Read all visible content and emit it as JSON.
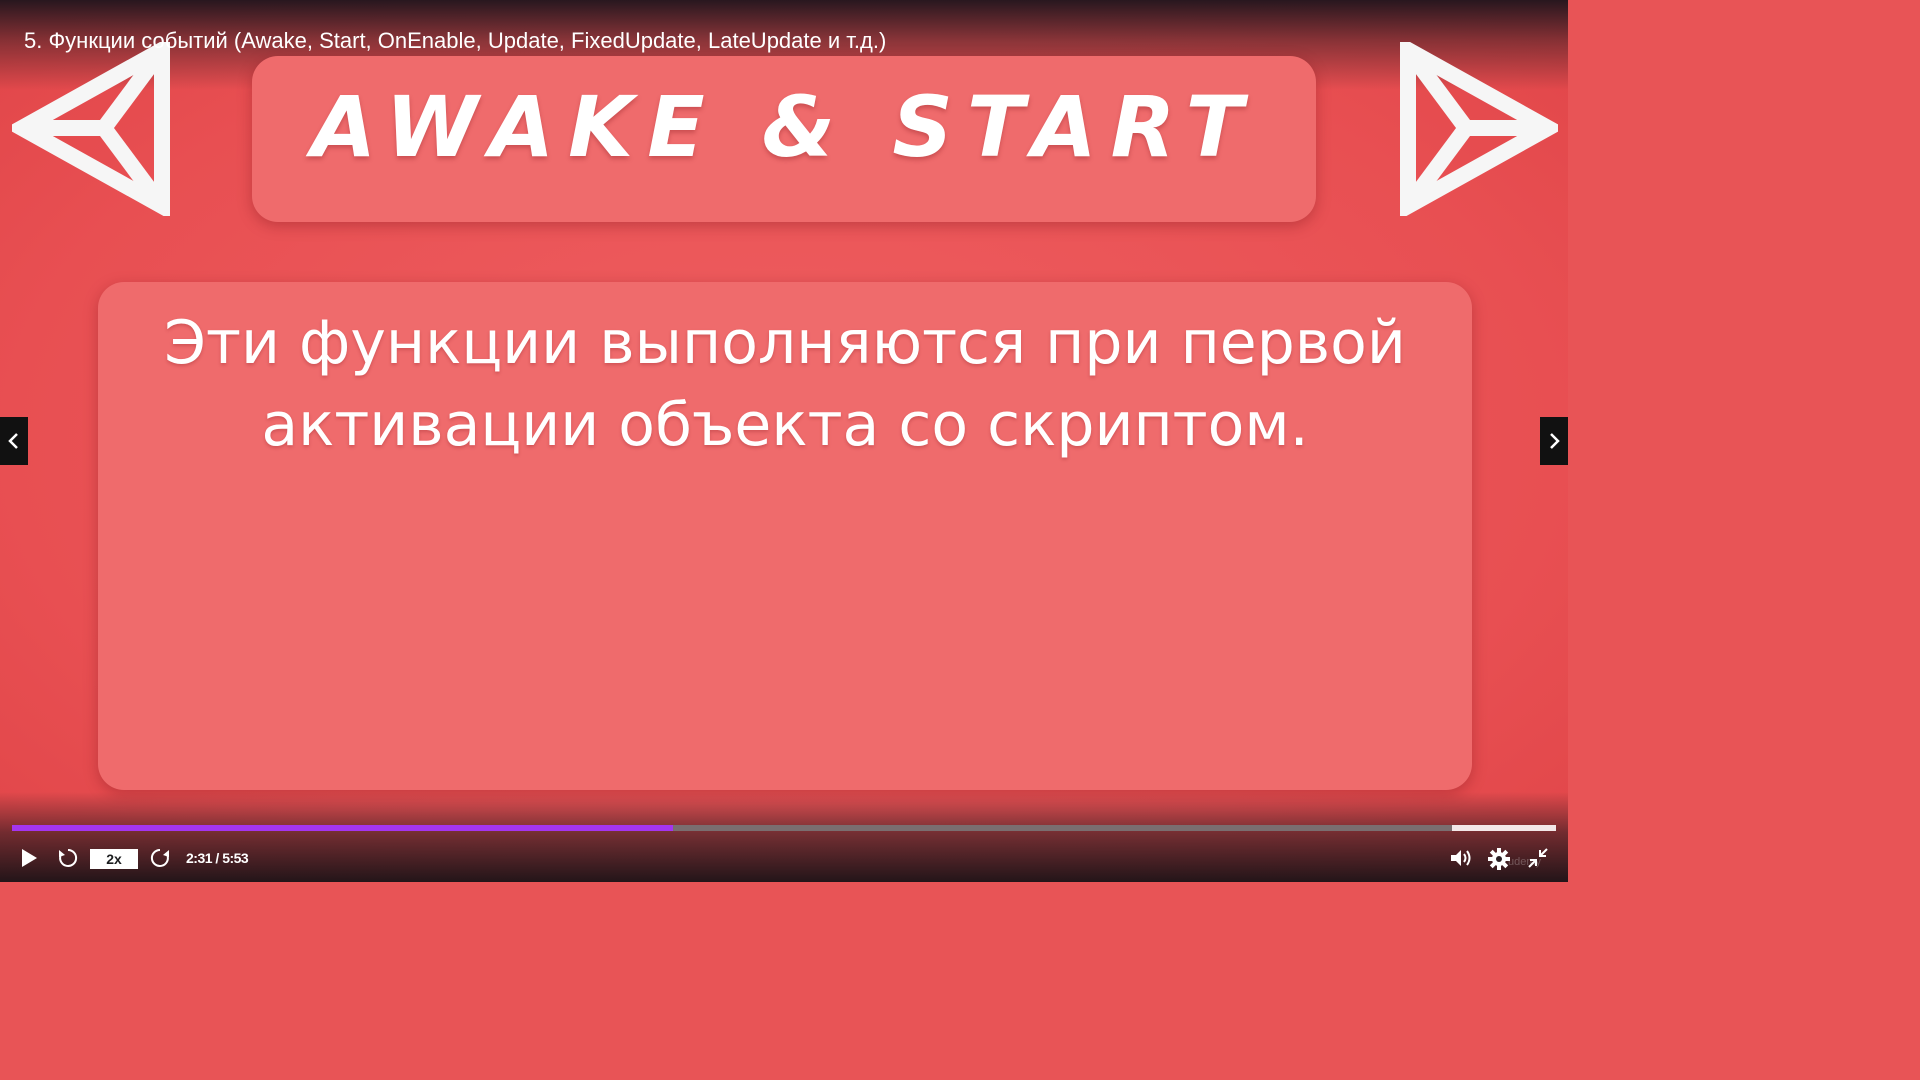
{
  "player": {
    "lecture_title": "5. Функции событий (Awake, Start, OnEnable, Update, FixedUpdate, LateUpdate и т.д.)",
    "watermark": "udemy"
  },
  "slide": {
    "heading": "AWAKE & START",
    "body": "Эти функции выполняются при первой активации объекта со скриптом.",
    "logo_icon": "unity-logo-icon"
  },
  "controls": {
    "speed_label": "2x",
    "time_label": "2:31 / 5:53",
    "progress_played_fraction": 0.428,
    "progress_buffered_fraction": 1.0,
    "icons": {
      "play": "play-icon",
      "rewind": "rewind-5s-icon",
      "forward": "forward-5s-icon",
      "volume": "volume-icon",
      "settings": "gear-icon",
      "exit_fullscreen": "exit-fullscreen-icon",
      "prev": "chevron-left-icon",
      "next": "chevron-right-icon"
    }
  },
  "colors": {
    "background": "#e85456",
    "card": "#ef6b6c",
    "progress_played": "#a435f0",
    "progress_track": "#7a6e70",
    "text": "#ffffff"
  }
}
